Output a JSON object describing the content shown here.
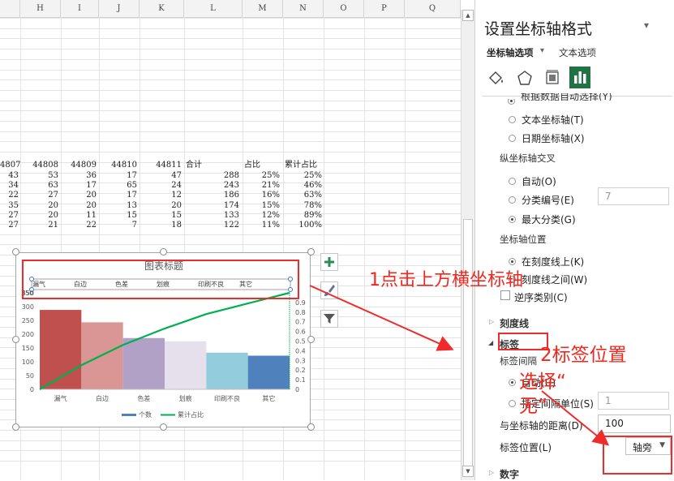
{
  "sheet": {
    "columns": [
      "H",
      "I",
      "J",
      "K",
      "L",
      "M",
      "N",
      "O",
      "P",
      "Q"
    ],
    "header_row": [
      "4807",
      "44808",
      "44809",
      "44810",
      "44811",
      "合计",
      "占比",
      "累计占比"
    ],
    "rows": [
      [
        "43",
        "53",
        "36",
        "17",
        "47",
        "288",
        "25%",
        "25%"
      ],
      [
        "34",
        "63",
        "17",
        "65",
        "24",
        "243",
        "21%",
        "46%"
      ],
      [
        "22",
        "27",
        "20",
        "17",
        "12",
        "186",
        "16%",
        "63%"
      ],
      [
        "35",
        "20",
        "20",
        "13",
        "20",
        "174",
        "15%",
        "78%"
      ],
      [
        "27",
        "20",
        "11",
        "15",
        "15",
        "133",
        "12%",
        "89%"
      ],
      [
        "27",
        "21",
        "22",
        "7",
        "18",
        "122",
        "11%",
        "100%"
      ]
    ]
  },
  "chart": {
    "title": "图表标题",
    "legend": [
      "个数",
      "累计占比"
    ],
    "colors": [
      "#c0504d",
      "#d99694",
      "#b2a1c7",
      "#e6e0ec",
      "#93cddd",
      "#4f81bd"
    ],
    "line_color": "#00b050"
  },
  "chart_data": {
    "type": "bar",
    "title": "图表标题",
    "categories": [
      "漏气",
      "白边",
      "色差",
      "划痕",
      "印刷不良",
      "其它"
    ],
    "series": [
      {
        "name": "个数",
        "values": [
          288,
          243,
          186,
          174,
          133,
          122
        ]
      },
      {
        "name": "累计占比",
        "type": "line",
        "axis": "right",
        "values": [
          0.25,
          0.46,
          0.63,
          0.78,
          0.89,
          1.0
        ]
      }
    ],
    "left_axis_ticks": [
      "0",
      "50",
      "100",
      "150",
      "200",
      "250",
      "300",
      "350"
    ],
    "right_axis_ticks": [
      "0",
      "0.1",
      "0.2",
      "0.3",
      "0.4",
      "0.5",
      "0.6",
      "0.7",
      "0.8",
      "0.9"
    ],
    "top_axis_labels": [
      "漏气",
      "白边",
      "色差",
      "划痕",
      "印刷不良",
      "其它"
    ],
    "ylim": [
      0,
      350
    ],
    "y2lim": [
      0,
      1
    ],
    "legend_position": "bottom"
  },
  "pane": {
    "title": "设置坐标轴格式",
    "tab_axis": "坐标轴选项",
    "tab_text": "文本选项",
    "cut_item": "根据数据自动选择(Y)",
    "opt_text_axis": "文本坐标轴(T)",
    "opt_date_axis": "日期坐标轴(X)",
    "sec_cross": "纵坐标轴交叉",
    "opt_auto": "自动(O)",
    "opt_cat_num": "分类编号(E)",
    "cat_num_value": "7",
    "opt_max_cat": "最大分类(G)",
    "sec_pos": "坐标轴位置",
    "opt_on_tick": "在刻度线上(K)",
    "opt_between": "刻度线之间(W)",
    "opt_reverse": "逆序类别(C)",
    "sec_ticks": "刻度线",
    "sec_labels": "标签",
    "label_interval": "标签间隔",
    "opt_auto2": "自动(U)",
    "opt_interval_unit": "指定间隔单位(S)",
    "interval_value": "1",
    "distance_label": "与坐标轴的距离(D)",
    "distance_value": "100",
    "label_pos": "标签位置(L)",
    "label_pos_value": "轴旁",
    "sec_number": "数字"
  },
  "annotations": {
    "a1": "1点击上方横坐标轴",
    "a2_line1": "2标签位置",
    "a2_line2": "选择“",
    "a2_line3": "无”"
  }
}
